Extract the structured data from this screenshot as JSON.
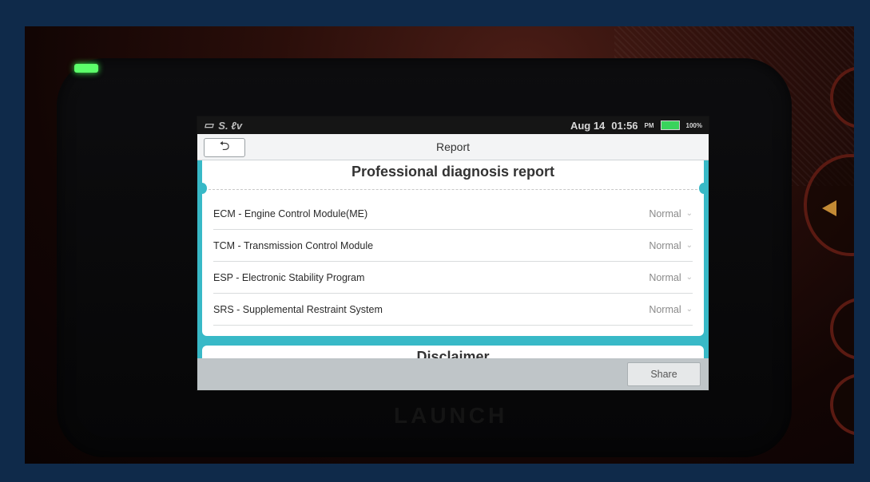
{
  "statusbar": {
    "left_text": "S. ℓv",
    "date": "Aug 14",
    "time": "01:56",
    "ampm": "PM",
    "battery": "100%"
  },
  "titlebar": {
    "title": "Report",
    "back_icon": "back-arrow-icon"
  },
  "report": {
    "heading": "Professional diagnosis report",
    "systems": [
      {
        "name": "ECM - Engine Control Module(ME)",
        "status": "Normal"
      },
      {
        "name": "TCM - Transmission Control Module",
        "status": "Normal"
      },
      {
        "name": "ESP - Electronic Stability Program",
        "status": "Normal"
      },
      {
        "name": "SRS - Supplemental Restraint System",
        "status": "Normal"
      }
    ],
    "next_section_heading": "Disclaimer"
  },
  "footer": {
    "share_label": "Share"
  },
  "device": {
    "brand": "LAUNCH"
  },
  "colors": {
    "accent": "#38b9c7",
    "background": "#0f2a4a"
  }
}
